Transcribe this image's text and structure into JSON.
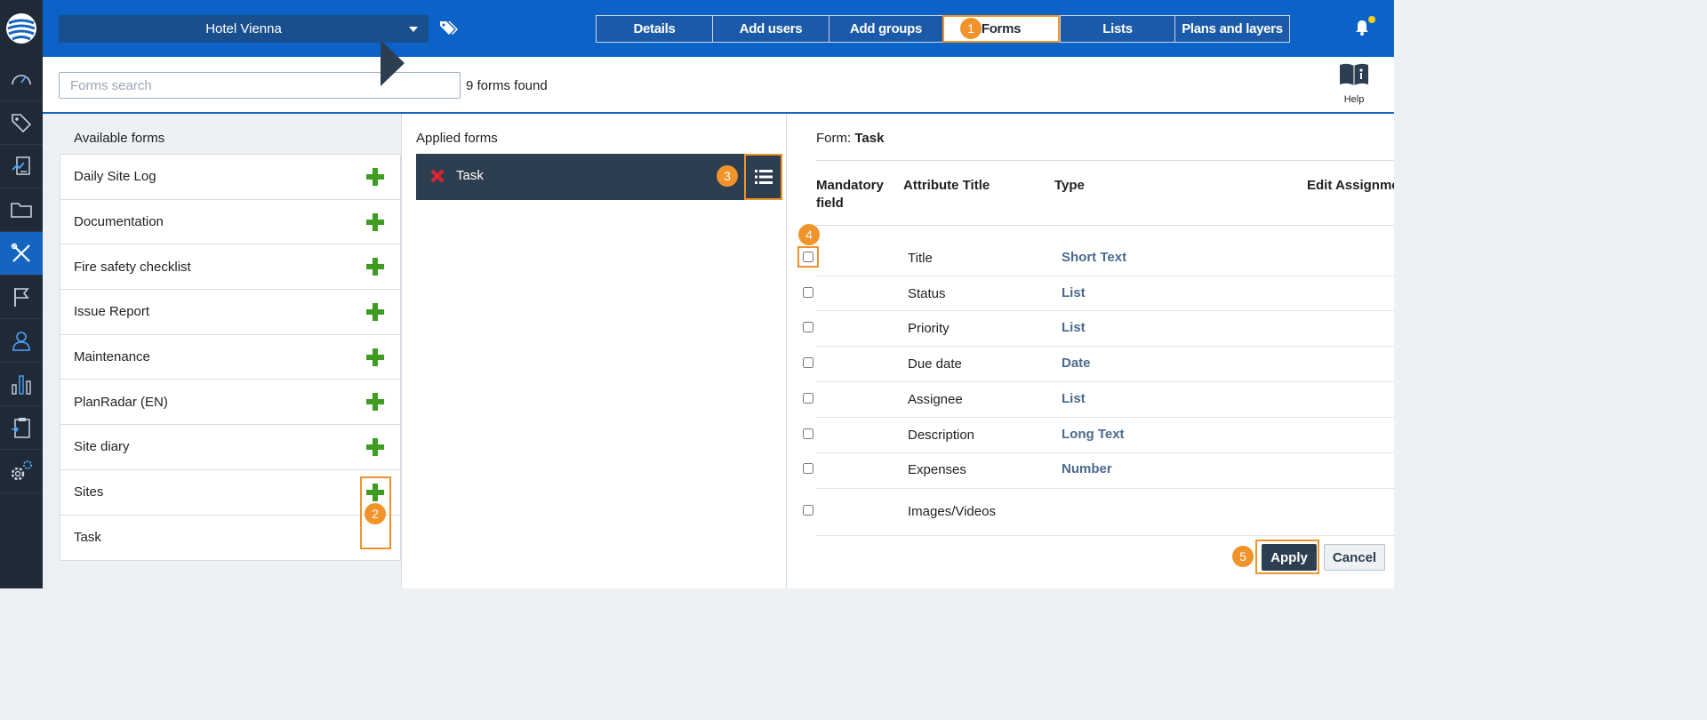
{
  "project": {
    "name": "Hotel Vienna"
  },
  "tabs": [
    {
      "label": "Details",
      "active": false
    },
    {
      "label": "Add users",
      "active": false
    },
    {
      "label": "Add groups",
      "active": false
    },
    {
      "label": "Forms",
      "active": true
    },
    {
      "label": "Lists",
      "active": false
    },
    {
      "label": "Plans and layers",
      "active": false
    }
  ],
  "search": {
    "placeholder": "Forms search",
    "value": "",
    "results_text": "9 forms found"
  },
  "help": {
    "label": "Help"
  },
  "available": {
    "title": "Available forms",
    "forms": [
      "Daily Site Log",
      "Documentation",
      "Fire safety checklist",
      "Issue Report",
      "Maintenance",
      "PlanRadar (EN)",
      "Site diary",
      "Sites",
      "Task"
    ]
  },
  "applied": {
    "title": "Applied forms",
    "forms": [
      "Task"
    ]
  },
  "detail": {
    "form_label": "Form:",
    "form_name": "Task",
    "headers": {
      "mandatory": "Mandatory field",
      "attribute_title": "Attribute Title",
      "type": "Type",
      "edit_assignment": "Edit Assignment"
    },
    "attributes": [
      {
        "title": "Title",
        "type": "Short Text"
      },
      {
        "title": "Status",
        "type": "List"
      },
      {
        "title": "Priority",
        "type": "List"
      },
      {
        "title": "Due date",
        "type": "Date"
      },
      {
        "title": "Assignee",
        "type": "List"
      },
      {
        "title": "Description",
        "type": "Long Text"
      },
      {
        "title": "Expenses",
        "type": "Number"
      },
      {
        "title": "Images/Videos",
        "type": ""
      }
    ],
    "apply_label": "Apply",
    "cancel_label": "Cancel"
  },
  "callouts": [
    "1",
    "2",
    "3",
    "4",
    "5"
  ],
  "colors": {
    "topbar": "#0b63c7",
    "rail": "#1f2a36",
    "accent_orange": "#f0932b",
    "add_green": "#3f9b22",
    "dark_row": "#2d3e50"
  },
  "icons": {
    "nav": [
      "dashboard-icon",
      "tags-icon",
      "reports-icon",
      "folder-icon",
      "tools-icon",
      "flag-icon",
      "user-icon",
      "statistics-icon",
      "clipboard-icon",
      "settings-icon"
    ]
  }
}
